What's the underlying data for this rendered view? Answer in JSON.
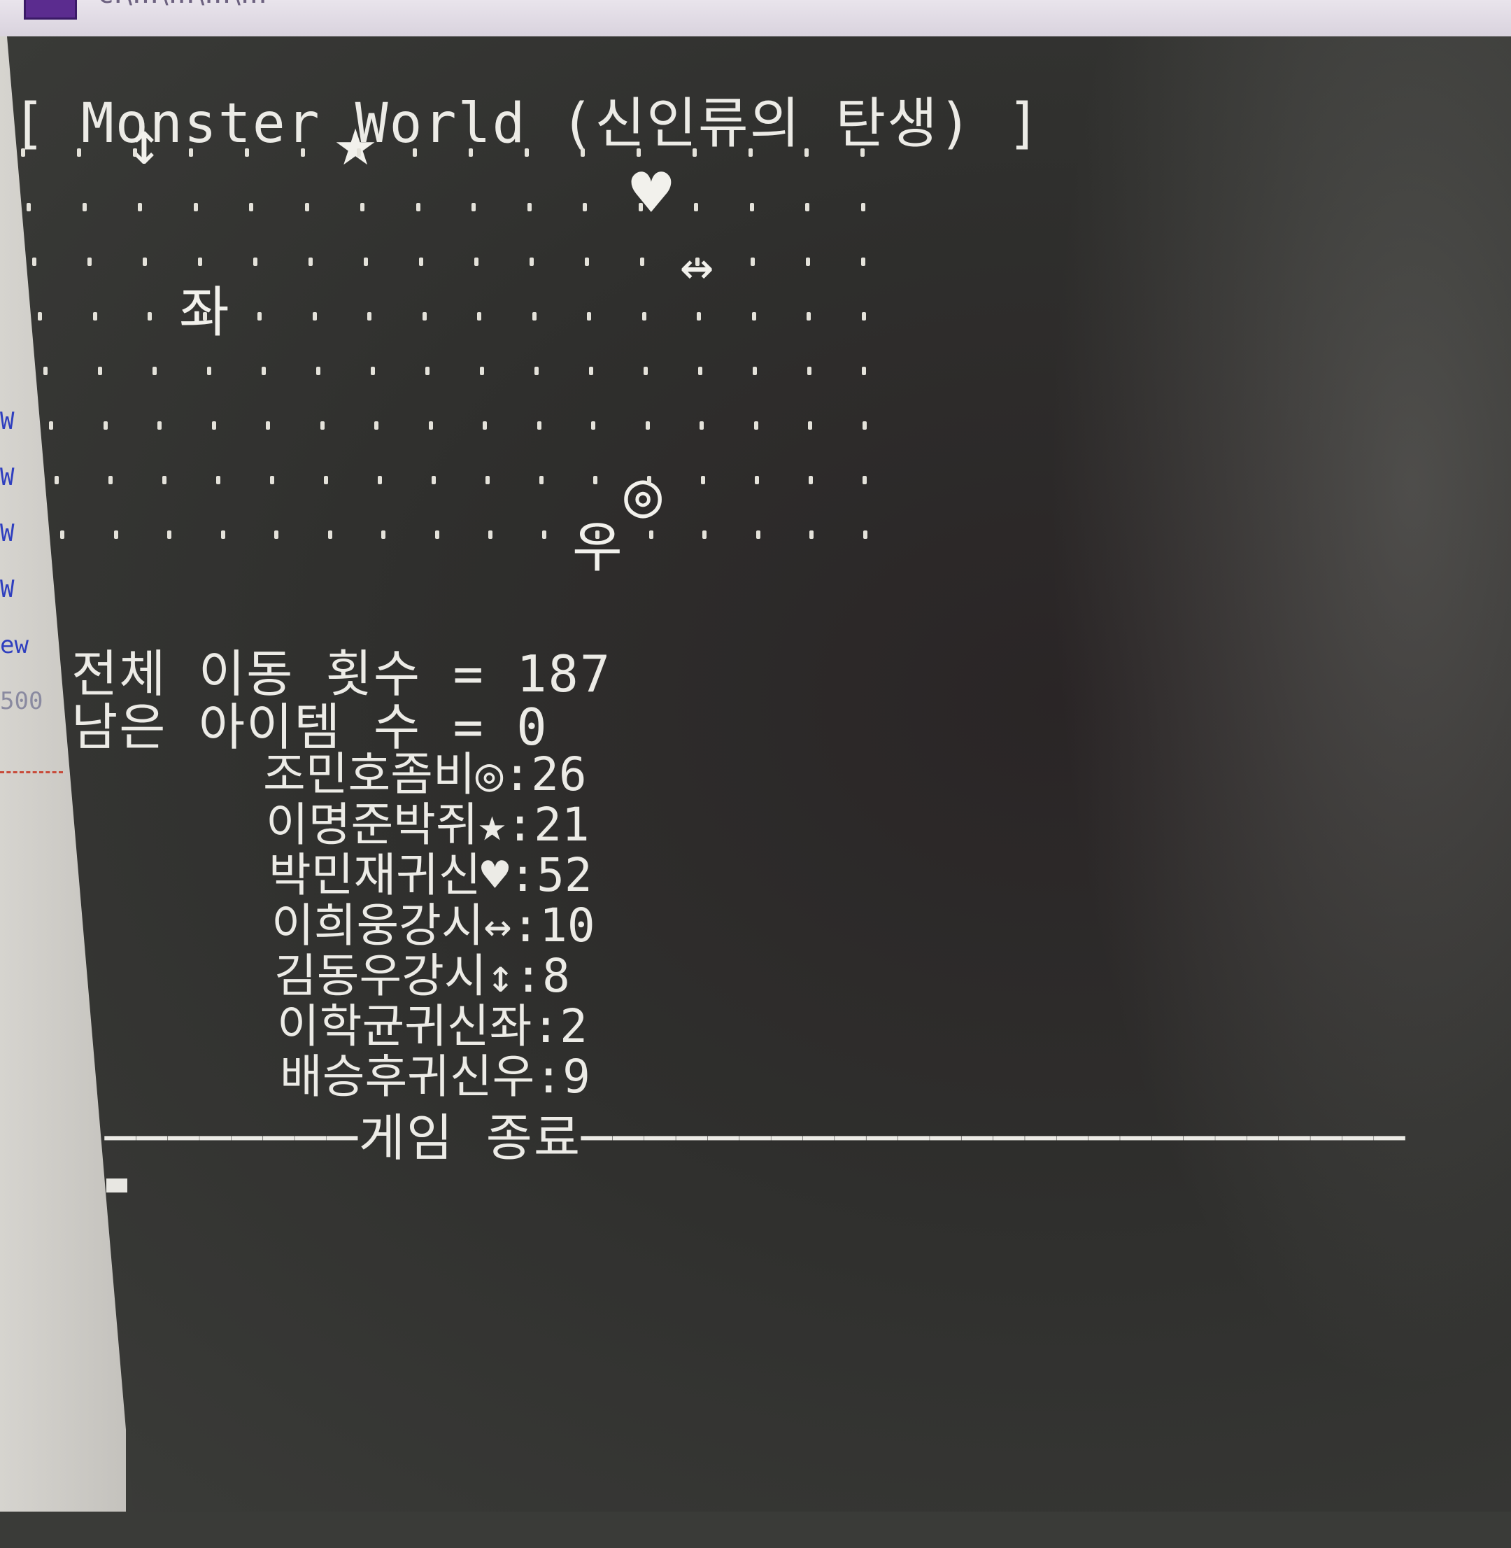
{
  "window": {
    "titlebar_text": "c:\\...\\...\\...\\..."
  },
  "editor_gutter": [
    "W",
    "W",
    "W",
    "W",
    "ew",
    "500"
  ],
  "console": {
    "title": "[ Monster World (신인류의 탄생) ]",
    "map_symbols": {
      "updown_arrow": "↕",
      "star": "★",
      "heart": "♥",
      "leftright_arrow": "↔",
      "left_char": "좌",
      "bullseye": "◎",
      "right_char": "우"
    },
    "stats": {
      "total_moves_label": "전체 이동 횟수",
      "total_moves_value": "187",
      "remaining_items_label": "남은 아이템 수",
      "remaining_items_value": "0"
    },
    "legend": [
      {
        "name": "조민호좀비",
        "symbol": "◎",
        "value": "26"
      },
      {
        "name": "이명준박쥐",
        "symbol": "★",
        "value": "21"
      },
      {
        "name": "박민재귀신",
        "symbol": "♥",
        "value": "52"
      },
      {
        "name": "이희웅강시",
        "symbol": "↔",
        "value": "10"
      },
      {
        "name": "김동우강시",
        "symbol": "↕",
        "value": "8"
      },
      {
        "name": "이학균귀신",
        "symbol": "좌",
        "value": "2"
      },
      {
        "name": "배승후귀신",
        "symbol": "우",
        "value": "9"
      }
    ],
    "game_over": "게임 종료"
  }
}
